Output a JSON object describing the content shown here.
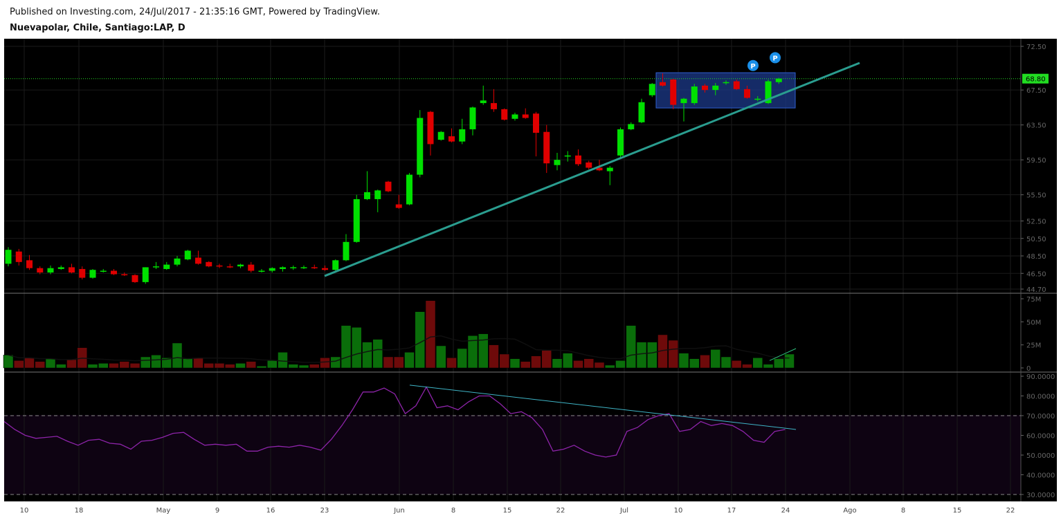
{
  "header": {
    "published": "Published on Investing.com, 24/Jul/2017 - 21:35:16 GMT, Powered by TradingView.",
    "instrument": "Nuevapolar, Chile, Santiago:LAP, D"
  },
  "colors": {
    "up": "#00e000",
    "down": "#e00000",
    "vol_up": "#0a6e0a",
    "vol_down": "#6e0a0a",
    "trend": "#2a9d8f",
    "rsi": "#8e24aa",
    "rsi_trend": "#3fb6c8",
    "last_price": "#22dd22",
    "box": "#1c3a8a",
    "marker": "#1a8fe8"
  },
  "chart_data": [
    {
      "type": "candlestick",
      "x_labels": [
        "10",
        "18",
        "May",
        "9",
        "16",
        "23",
        "Jun",
        "8",
        "15",
        "22",
        "Jul",
        "10",
        "17",
        "24",
        "Ago",
        "8",
        "15",
        "22"
      ],
      "y_ticks": [
        "72.50",
        "67.50",
        "63.50",
        "59.50",
        "55.50",
        "52.50",
        "50.50",
        "48.50",
        "46.50",
        "44.70"
      ],
      "ylim": [
        44.7,
        72.5
      ],
      "last_price": "68.80",
      "markers": [
        "P",
        "P"
      ],
      "candles": [
        {
          "o": 47.6,
          "h": 49.5,
          "l": 47.3,
          "c": 49.2
        },
        {
          "o": 49.0,
          "h": 49.3,
          "l": 47.4,
          "c": 47.8
        },
        {
          "o": 48.0,
          "h": 48.6,
          "l": 46.9,
          "c": 47.1
        },
        {
          "o": 47.1,
          "h": 47.3,
          "l": 46.4,
          "c": 46.6
        },
        {
          "o": 46.6,
          "h": 47.4,
          "l": 46.4,
          "c": 47.1
        },
        {
          "o": 47.0,
          "h": 47.4,
          "l": 46.9,
          "c": 47.2
        },
        {
          "o": 47.2,
          "h": 47.6,
          "l": 46.5,
          "c": 46.6
        },
        {
          "o": 47.0,
          "h": 47.3,
          "l": 45.8,
          "c": 46.0
        },
        {
          "o": 46.0,
          "h": 47.0,
          "l": 45.9,
          "c": 46.9
        },
        {
          "o": 46.8,
          "h": 47.0,
          "l": 46.6,
          "c": 46.8
        },
        {
          "o": 46.8,
          "h": 47.0,
          "l": 46.3,
          "c": 46.4
        },
        {
          "o": 46.4,
          "h": 46.6,
          "l": 46.2,
          "c": 46.3
        },
        {
          "o": 46.3,
          "h": 46.4,
          "l": 45.4,
          "c": 45.5
        },
        {
          "o": 45.5,
          "h": 47.2,
          "l": 45.3,
          "c": 47.2
        },
        {
          "o": 47.2,
          "h": 47.8,
          "l": 47.0,
          "c": 47.3
        },
        {
          "o": 47.0,
          "h": 47.8,
          "l": 46.9,
          "c": 47.5
        },
        {
          "o": 47.5,
          "h": 48.5,
          "l": 47.3,
          "c": 48.2
        },
        {
          "o": 48.1,
          "h": 49.2,
          "l": 48.0,
          "c": 49.1
        },
        {
          "o": 48.3,
          "h": 49.1,
          "l": 47.5,
          "c": 47.6
        },
        {
          "o": 47.8,
          "h": 47.9,
          "l": 47.2,
          "c": 47.3
        },
        {
          "o": 47.4,
          "h": 47.6,
          "l": 47.1,
          "c": 47.3
        },
        {
          "o": 47.3,
          "h": 47.6,
          "l": 47.1,
          "c": 47.2
        },
        {
          "o": 47.3,
          "h": 47.6,
          "l": 47.1,
          "c": 47.5
        },
        {
          "o": 47.5,
          "h": 47.8,
          "l": 46.6,
          "c": 46.8
        },
        {
          "o": 46.8,
          "h": 47.0,
          "l": 46.6,
          "c": 46.8
        },
        {
          "o": 46.8,
          "h": 47.2,
          "l": 46.6,
          "c": 47.1
        },
        {
          "o": 47.0,
          "h": 47.3,
          "l": 46.7,
          "c": 47.2
        },
        {
          "o": 47.2,
          "h": 47.4,
          "l": 46.9,
          "c": 47.2
        },
        {
          "o": 47.2,
          "h": 47.4,
          "l": 47.0,
          "c": 47.2
        },
        {
          "o": 47.2,
          "h": 47.5,
          "l": 47.0,
          "c": 47.1
        },
        {
          "o": 47.1,
          "h": 47.4,
          "l": 46.8,
          "c": 46.9
        },
        {
          "o": 46.9,
          "h": 48.1,
          "l": 46.8,
          "c": 48.0
        },
        {
          "o": 48.0,
          "h": 51.0,
          "l": 47.9,
          "c": 50.1
        },
        {
          "o": 50.1,
          "h": 55.5,
          "l": 50.0,
          "c": 55.0
        },
        {
          "o": 55.0,
          "h": 58.2,
          "l": 54.9,
          "c": 55.8
        },
        {
          "o": 55.0,
          "h": 56.1,
          "l": 53.5,
          "c": 56.0
        },
        {
          "o": 57.0,
          "h": 57.1,
          "l": 55.8,
          "c": 55.9
        },
        {
          "o": 54.4,
          "h": 55.5,
          "l": 53.9,
          "c": 54.0
        },
        {
          "o": 54.4,
          "h": 58.0,
          "l": 54.3,
          "c": 57.8
        },
        {
          "o": 57.8,
          "h": 65.2,
          "l": 57.5,
          "c": 64.3
        },
        {
          "o": 65.0,
          "h": 65.1,
          "l": 60.0,
          "c": 61.3
        },
        {
          "o": 61.8,
          "h": 62.8,
          "l": 61.7,
          "c": 62.7
        },
        {
          "o": 62.2,
          "h": 63.1,
          "l": 61.5,
          "c": 61.6
        },
        {
          "o": 61.6,
          "h": 64.2,
          "l": 61.3,
          "c": 63.0
        },
        {
          "o": 63.0,
          "h": 65.6,
          "l": 62.3,
          "c": 65.5
        },
        {
          "o": 66.0,
          "h": 68.0,
          "l": 65.8,
          "c": 66.3
        },
        {
          "o": 66.0,
          "h": 67.6,
          "l": 65.0,
          "c": 65.3
        },
        {
          "o": 65.3,
          "h": 65.4,
          "l": 64.0,
          "c": 64.1
        },
        {
          "o": 64.2,
          "h": 64.9,
          "l": 64.0,
          "c": 64.7
        },
        {
          "o": 64.7,
          "h": 65.4,
          "l": 64.2,
          "c": 64.3
        },
        {
          "o": 64.8,
          "h": 65.0,
          "l": 59.9,
          "c": 62.6
        },
        {
          "o": 62.7,
          "h": 63.5,
          "l": 58.0,
          "c": 59.1
        },
        {
          "o": 58.9,
          "h": 60.3,
          "l": 58.3,
          "c": 59.5
        },
        {
          "o": 59.9,
          "h": 60.5,
          "l": 59.3,
          "c": 60.0
        },
        {
          "o": 60.0,
          "h": 60.7,
          "l": 58.8,
          "c": 59.0
        },
        {
          "o": 59.2,
          "h": 59.4,
          "l": 58.4,
          "c": 58.6
        },
        {
          "o": 58.6,
          "h": 59.5,
          "l": 58.2,
          "c": 58.3
        },
        {
          "o": 58.2,
          "h": 58.8,
          "l": 56.6,
          "c": 58.6
        },
        {
          "o": 60.0,
          "h": 63.2,
          "l": 59.7,
          "c": 63.0
        },
        {
          "o": 63.0,
          "h": 63.8,
          "l": 62.9,
          "c": 63.6
        },
        {
          "o": 63.8,
          "h": 66.5,
          "l": 63.7,
          "c": 66.1
        },
        {
          "o": 66.9,
          "h": 68.3,
          "l": 66.7,
          "c": 68.2
        },
        {
          "o": 68.4,
          "h": 69.4,
          "l": 67.9,
          "c": 68.0
        },
        {
          "o": 68.7,
          "h": 68.8,
          "l": 65.3,
          "c": 65.8
        },
        {
          "o": 66.0,
          "h": 66.6,
          "l": 63.9,
          "c": 66.5
        },
        {
          "o": 66.0,
          "h": 68.2,
          "l": 65.8,
          "c": 67.9
        },
        {
          "o": 68.0,
          "h": 68.2,
          "l": 67.2,
          "c": 67.5
        },
        {
          "o": 67.5,
          "h": 68.3,
          "l": 66.9,
          "c": 68.0
        },
        {
          "o": 68.3,
          "h": 68.6,
          "l": 68.1,
          "c": 68.4
        },
        {
          "o": 68.5,
          "h": 68.7,
          "l": 67.5,
          "c": 67.6
        },
        {
          "o": 67.6,
          "h": 68.0,
          "l": 66.5,
          "c": 66.6
        },
        {
          "o": 66.4,
          "h": 66.8,
          "l": 66.2,
          "c": 66.5
        },
        {
          "o": 66.0,
          "h": 68.7,
          "l": 65.9,
          "c": 68.5
        },
        {
          "o": 68.4,
          "h": 68.9,
          "l": 68.2,
          "c": 68.8
        }
      ]
    },
    {
      "type": "bar",
      "y_ticks": [
        "75M",
        "50M",
        "25M",
        "0"
      ],
      "ylim": [
        0,
        75
      ],
      "values": [
        14,
        8,
        11,
        7,
        10,
        4,
        9,
        22,
        4,
        5,
        5,
        7,
        5,
        12,
        14,
        11,
        27,
        10,
        11,
        5,
        5,
        4,
        5,
        7,
        2,
        8,
        17,
        4,
        3,
        4,
        11,
        12,
        46,
        44,
        28,
        31,
        12,
        12,
        17,
        61,
        73,
        24,
        11,
        21,
        35,
        37,
        25,
        15,
        10,
        7,
        13,
        19,
        10,
        16,
        8,
        10,
        6,
        3,
        8,
        46,
        28,
        28,
        36,
        30,
        16,
        10,
        14,
        20,
        12,
        8,
        4,
        11,
        4,
        10,
        15
      ]
    },
    {
      "type": "line",
      "y_ticks": [
        "90.0000",
        "80.0000",
        "70.0000",
        "60.0000",
        "50.0000",
        "40.0000",
        "30.0000"
      ],
      "ylim": [
        27,
        91
      ],
      "bands": [
        70,
        30
      ],
      "values": [
        67,
        63,
        60,
        58.5,
        59,
        59.5,
        57,
        55,
        57.5,
        58,
        56,
        55.5,
        53,
        57,
        57.5,
        59,
        61,
        61.5,
        58,
        55,
        55.5,
        55,
        55.5,
        52,
        52,
        54,
        54.5,
        54,
        55,
        54,
        52.5,
        58,
        65,
        73,
        82,
        82,
        84,
        81,
        71,
        75,
        84.5,
        74,
        75,
        73,
        77,
        80,
        80,
        76,
        71,
        72,
        69,
        63,
        52,
        53,
        55,
        52,
        50,
        49,
        50,
        62,
        64,
        68,
        70,
        71,
        62,
        63,
        67,
        65,
        66,
        65,
        62,
        57.5,
        56.5,
        62,
        63
      ]
    }
  ]
}
